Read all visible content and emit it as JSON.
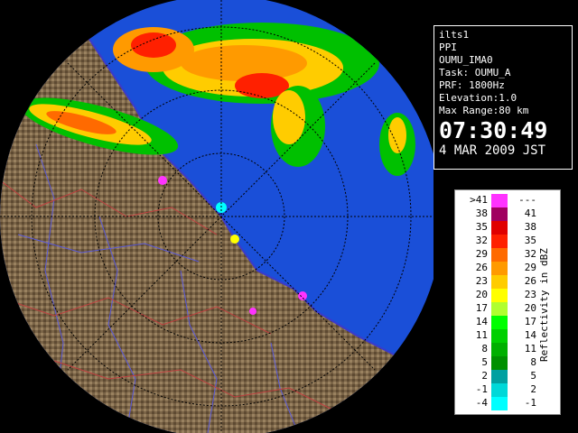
{
  "info": {
    "station": "ilts1",
    "scan_type": "PPI",
    "site": "OUMU_IMA0",
    "task": "Task: OUMU_A",
    "prf": "PRF: 1800Hz",
    "elevation": "Elevation:1.0",
    "max_range": "Max Range:80 km",
    "time": "07:30:49",
    "date": "4 MAR 2009 JST"
  },
  "legend": {
    "unit": "Reflectivity in dBZ",
    "rows": [
      {
        "lo": ">41",
        "hi": "---",
        "color": "#ff33ff"
      },
      {
        "lo": "38",
        "hi": "41",
        "color": "#a00060"
      },
      {
        "lo": "35",
        "hi": "38",
        "color": "#e00000"
      },
      {
        "lo": "32",
        "hi": "35",
        "color": "#ff2000"
      },
      {
        "lo": "29",
        "hi": "32",
        "color": "#ff6a00"
      },
      {
        "lo": "26",
        "hi": "29",
        "color": "#ff9a00"
      },
      {
        "lo": "23",
        "hi": "26",
        "color": "#ffcc00"
      },
      {
        "lo": "20",
        "hi": "23",
        "color": "#ffff00"
      },
      {
        "lo": "17",
        "hi": "20",
        "color": "#b0ff30"
      },
      {
        "lo": "14",
        "hi": "17",
        "color": "#00ff00"
      },
      {
        "lo": "11",
        "hi": "14",
        "color": "#00d000"
      },
      {
        "lo": "8",
        "hi": "11",
        "color": "#00b000"
      },
      {
        "lo": "5",
        "hi": "8",
        "color": "#009000"
      },
      {
        "lo": "2",
        "hi": "5",
        "color": "#00a0a0"
      },
      {
        "lo": "-1",
        "hi": "2",
        "color": "#00d8d8"
      },
      {
        "lo": "-4",
        "hi": "-1",
        "color": "#00ffff"
      }
    ]
  },
  "colors": {
    "ocean": "#1a4fd8",
    "land": "#7a6447",
    "background": "#000000"
  }
}
